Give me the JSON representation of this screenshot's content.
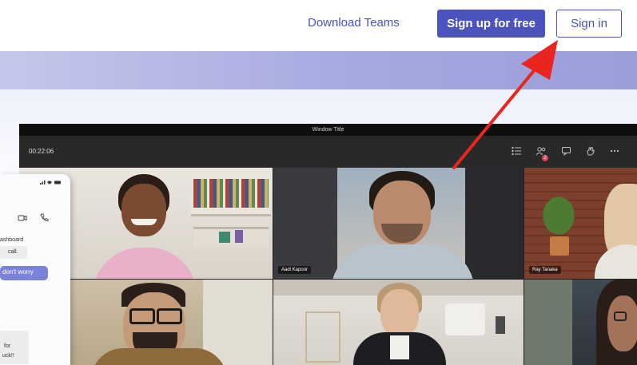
{
  "nav": {
    "download_label": "Download Teams",
    "signup_label": "Sign up for free",
    "signin_label": "Sign in"
  },
  "window": {
    "title": "Window Title",
    "timer": "00:22:06",
    "badge_count": "2",
    "toolbar_icons": [
      "participants-icon",
      "chat-icon",
      "reactions-icon",
      "raise-hand-icon",
      "more-options-icon"
    ]
  },
  "participants": [
    {
      "name": "Aadi Kapoor"
    },
    {
      "name": "Ray Tanaka"
    }
  ],
  "phone": {
    "status_icons": [
      "signal-icon",
      "wifi-icon",
      "battery-icon"
    ],
    "header_icons": [
      "video-call-icon",
      "phone-call-icon"
    ],
    "line1": "ashboard",
    "line2": "call.",
    "chip": "don't worry",
    "line3": "for",
    "line4": "uck!!"
  },
  "colors": {
    "brand": "#4b53bc",
    "band": "#a6a9df",
    "arrow": "#e8261f",
    "badge": "#d74654"
  }
}
